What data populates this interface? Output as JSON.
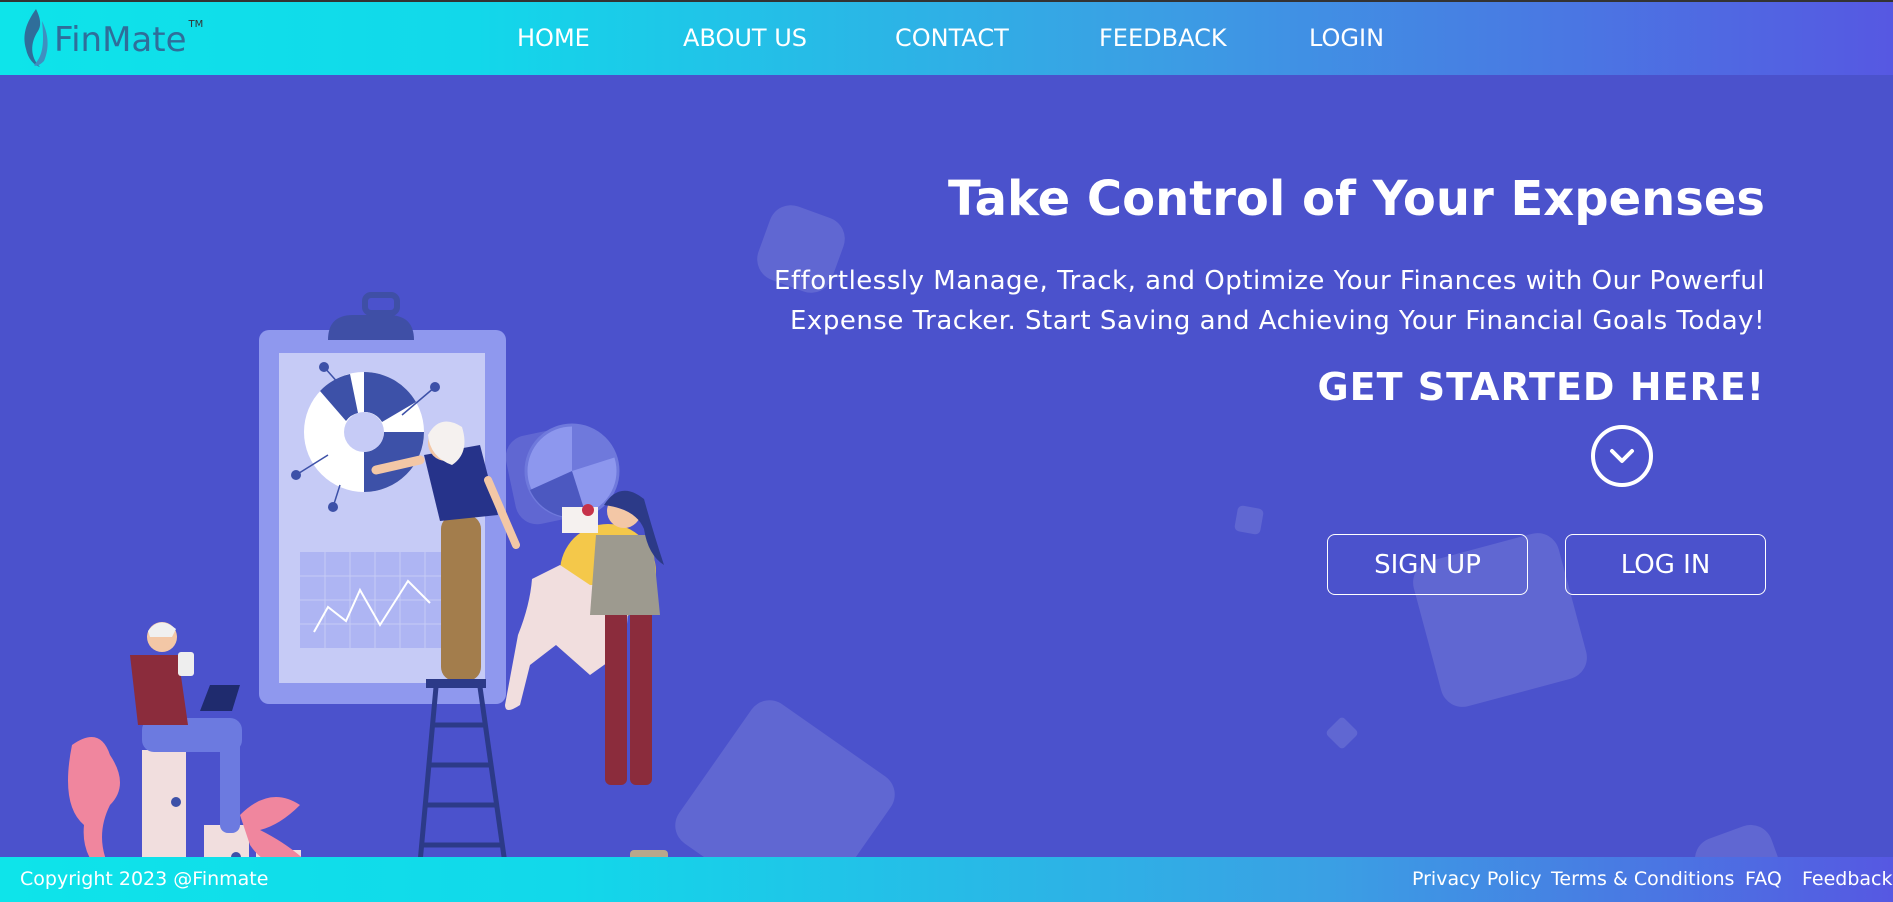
{
  "brand": {
    "name": "FinMate",
    "trademark": "TM"
  },
  "nav": {
    "items": [
      {
        "label": "HOME"
      },
      {
        "label": "ABOUT US"
      },
      {
        "label": "CONTACT"
      },
      {
        "label": "FEEDBACK"
      },
      {
        "label": "LOGIN"
      }
    ]
  },
  "hero": {
    "title": "Take Control of Your Expenses",
    "subtitle": "Effortlessly Manage, Track, and Optimize Your Finances with Our Powerful Expense Tracker. Start Saving and Achieving Your Financial Goals Today!",
    "cta": "GET STARTED HERE!",
    "signup_label": "SIGN UP",
    "login_label": "LOG IN",
    "chevron_icon": "chevron-down-icon",
    "illustration_icon": "finance-team-illustration"
  },
  "footer": {
    "copyright": "Copyright 2023 @Finmate",
    "links": [
      {
        "label": "Privacy Policy"
      },
      {
        "label": "Terms & Conditions"
      },
      {
        "label": "FAQ"
      },
      {
        "label": "Feedback"
      }
    ]
  },
  "colors": {
    "background": "#4b52cc",
    "nav_gradient_start": "#0ee4ea",
    "nav_gradient_end": "#5658e2",
    "text": "#ffffff"
  }
}
